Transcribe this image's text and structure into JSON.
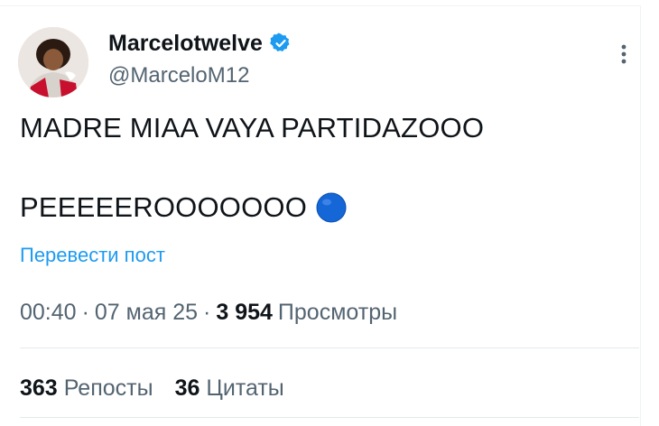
{
  "author": {
    "display_name": "Marcelotwelve",
    "handle": "@MarceloM12",
    "avatar_icon": "profile-photo",
    "verified_icon": "verified-badge-icon"
  },
  "tweet": {
    "line1": "MADRE MIAA VAYA PARTIDAZOOO",
    "line2": "PEEEEEROOOOOOO",
    "emoji_icon": "blue-circle-icon",
    "translate_label": "Перевести пост"
  },
  "meta": {
    "time": "00:40",
    "separator": "·",
    "date": "07 мая 25",
    "views_count": "3 954",
    "views_label": "Просмотры"
  },
  "stats": {
    "reposts_count": "363",
    "reposts_label": "Репосты",
    "quotes_count": "36",
    "quotes_label": "Цитаты"
  },
  "colors": {
    "accent": "#1d9bf0",
    "secondary_text": "#536471",
    "primary_text": "#0f1419"
  }
}
